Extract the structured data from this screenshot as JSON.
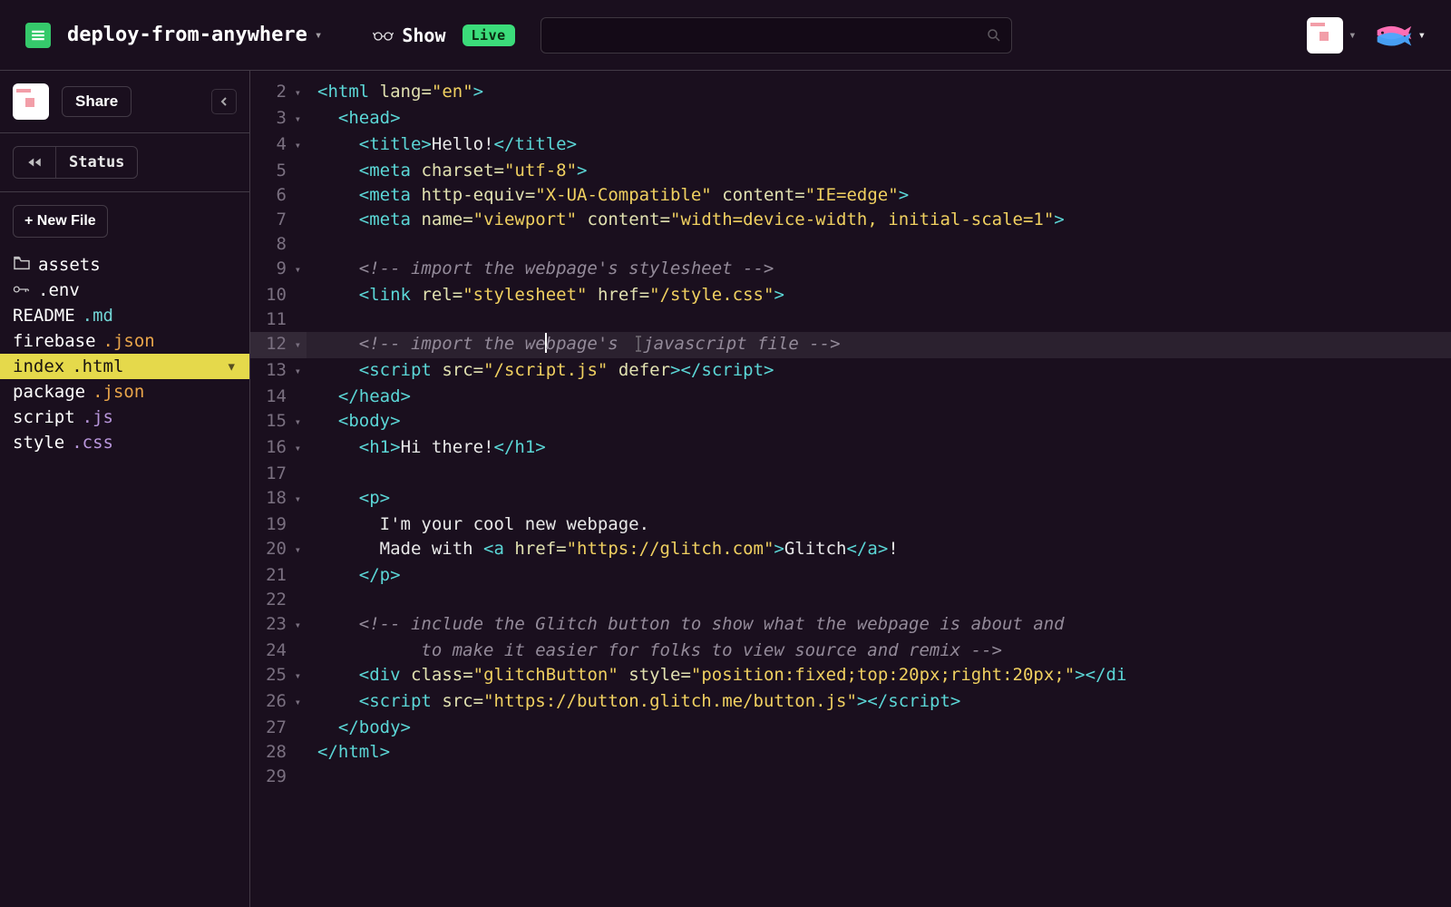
{
  "header": {
    "project_name": "deploy-from-anywhere",
    "show_label": "Show",
    "live_badge": "Live",
    "search_placeholder": ""
  },
  "sidebar": {
    "share_label": "Share",
    "status_label": "Status",
    "new_file_label": "+ New File",
    "files": [
      {
        "icon": "folder",
        "name": "assets",
        "ext": "",
        "active": false,
        "iconGlyph": "📁"
      },
      {
        "icon": "key",
        "name": ".env",
        "ext": "",
        "active": false,
        "iconGlyph": "🔑"
      },
      {
        "icon": "",
        "name": "README",
        "ext": ".md",
        "extClass": "ext-md",
        "active": false
      },
      {
        "icon": "",
        "name": "firebase",
        "ext": ".json",
        "extClass": "ext-json",
        "active": false
      },
      {
        "icon": "",
        "name": "index",
        "ext": ".html",
        "extClass": "ext-html",
        "active": true
      },
      {
        "icon": "",
        "name": "package",
        "ext": ".json",
        "extClass": "ext-json",
        "active": false
      },
      {
        "icon": "",
        "name": "script",
        "ext": ".js",
        "extClass": "ext-js",
        "active": false
      },
      {
        "icon": "",
        "name": "style",
        "ext": ".css",
        "extClass": "ext-css",
        "active": false
      }
    ]
  },
  "editor": {
    "highlight_line": 12,
    "lines": [
      {
        "n": 2,
        "fold": true,
        "indent": 0,
        "tokens": [
          [
            "tag",
            "<"
          ],
          [
            "name",
            "html"
          ],
          [
            "text",
            " "
          ],
          [
            "attr",
            "lang"
          ],
          [
            "eq",
            "="
          ],
          [
            "str",
            "\"en\""
          ],
          [
            "tag",
            ">"
          ]
        ]
      },
      {
        "n": 3,
        "fold": true,
        "indent": 1,
        "tokens": [
          [
            "tag",
            "<"
          ],
          [
            "name",
            "head"
          ],
          [
            "tag",
            ">"
          ]
        ]
      },
      {
        "n": 4,
        "fold": true,
        "indent": 2,
        "tokens": [
          [
            "tag",
            "<"
          ],
          [
            "name",
            "title"
          ],
          [
            "tag",
            ">"
          ],
          [
            "text",
            "Hello!"
          ],
          [
            "tag",
            "</"
          ],
          [
            "name",
            "title"
          ],
          [
            "tag",
            ">"
          ]
        ]
      },
      {
        "n": 5,
        "fold": false,
        "indent": 2,
        "tokens": [
          [
            "tag",
            "<"
          ],
          [
            "name",
            "meta"
          ],
          [
            "text",
            " "
          ],
          [
            "attr",
            "charset"
          ],
          [
            "eq",
            "="
          ],
          [
            "str",
            "\"utf-8\""
          ],
          [
            "tag",
            ">"
          ]
        ]
      },
      {
        "n": 6,
        "fold": false,
        "indent": 2,
        "tokens": [
          [
            "tag",
            "<"
          ],
          [
            "name",
            "meta"
          ],
          [
            "text",
            " "
          ],
          [
            "attr",
            "http-equiv"
          ],
          [
            "eq",
            "="
          ],
          [
            "str",
            "\"X-UA-Compatible\""
          ],
          [
            "text",
            " "
          ],
          [
            "attr",
            "content"
          ],
          [
            "eq",
            "="
          ],
          [
            "str",
            "\"IE=edge\""
          ],
          [
            "tag",
            ">"
          ]
        ]
      },
      {
        "n": 7,
        "fold": false,
        "indent": 2,
        "tokens": [
          [
            "tag",
            "<"
          ],
          [
            "name",
            "meta"
          ],
          [
            "text",
            " "
          ],
          [
            "attr",
            "name"
          ],
          [
            "eq",
            "="
          ],
          [
            "str",
            "\"viewport\""
          ],
          [
            "text",
            " "
          ],
          [
            "attr",
            "content"
          ],
          [
            "eq",
            "="
          ],
          [
            "str",
            "\"width=device-width, initial-scale=1\""
          ],
          [
            "tag",
            ">"
          ]
        ]
      },
      {
        "n": 8,
        "fold": false,
        "indent": 0,
        "tokens": []
      },
      {
        "n": 9,
        "fold": true,
        "indent": 2,
        "tokens": [
          [
            "comment",
            "<!-- import the webpage's stylesheet -->"
          ]
        ]
      },
      {
        "n": 10,
        "fold": false,
        "indent": 2,
        "tokens": [
          [
            "tag",
            "<"
          ],
          [
            "name",
            "link"
          ],
          [
            "text",
            " "
          ],
          [
            "attr",
            "rel"
          ],
          [
            "eq",
            "="
          ],
          [
            "str",
            "\"stylesheet\""
          ],
          [
            "text",
            " "
          ],
          [
            "attr",
            "href"
          ],
          [
            "eq",
            "="
          ],
          [
            "str",
            "\"/style.css\""
          ],
          [
            "tag",
            ">"
          ]
        ]
      },
      {
        "n": 11,
        "fold": false,
        "indent": 0,
        "tokens": []
      },
      {
        "n": 12,
        "fold": true,
        "indent": 2,
        "tokens": [
          [
            "comment",
            "<!-- import the we"
          ],
          [
            "cursor",
            ""
          ],
          [
            "comment",
            "bpage's "
          ],
          [
            "ibeam",
            ""
          ],
          [
            "comment",
            "javascript file -->"
          ]
        ]
      },
      {
        "n": 13,
        "fold": true,
        "indent": 2,
        "tokens": [
          [
            "tag",
            "<"
          ],
          [
            "name",
            "script"
          ],
          [
            "text",
            " "
          ],
          [
            "attr",
            "src"
          ],
          [
            "eq",
            "="
          ],
          [
            "str",
            "\"/script.js\""
          ],
          [
            "text",
            " "
          ],
          [
            "attr",
            "defer"
          ],
          [
            "tag",
            ">"
          ],
          [
            "tag",
            "</"
          ],
          [
            "name",
            "script"
          ],
          [
            "tag",
            ">"
          ]
        ]
      },
      {
        "n": 14,
        "fold": false,
        "indent": 1,
        "tokens": [
          [
            "tag",
            "</"
          ],
          [
            "name",
            "head"
          ],
          [
            "tag",
            ">"
          ]
        ]
      },
      {
        "n": 15,
        "fold": true,
        "indent": 1,
        "tokens": [
          [
            "tag",
            "<"
          ],
          [
            "name",
            "body"
          ],
          [
            "tag",
            ">"
          ]
        ]
      },
      {
        "n": 16,
        "fold": true,
        "indent": 2,
        "tokens": [
          [
            "tag",
            "<"
          ],
          [
            "name",
            "h1"
          ],
          [
            "tag",
            ">"
          ],
          [
            "text",
            "Hi there!"
          ],
          [
            "tag",
            "</"
          ],
          [
            "name",
            "h1"
          ],
          [
            "tag",
            ">"
          ]
        ]
      },
      {
        "n": 17,
        "fold": false,
        "indent": 0,
        "tokens": []
      },
      {
        "n": 18,
        "fold": true,
        "indent": 2,
        "tokens": [
          [
            "tag",
            "<"
          ],
          [
            "name",
            "p"
          ],
          [
            "tag",
            ">"
          ]
        ]
      },
      {
        "n": 19,
        "fold": false,
        "indent": 3,
        "tokens": [
          [
            "text",
            "I'm your cool new webpage."
          ]
        ]
      },
      {
        "n": 20,
        "fold": true,
        "indent": 3,
        "tokens": [
          [
            "text",
            "Made with "
          ],
          [
            "tag",
            "<"
          ],
          [
            "name",
            "a"
          ],
          [
            "text",
            " "
          ],
          [
            "attr",
            "href"
          ],
          [
            "eq",
            "="
          ],
          [
            "str",
            "\"https://glitch.com\""
          ],
          [
            "tag",
            ">"
          ],
          [
            "text",
            "Glitch"
          ],
          [
            "tag",
            "</"
          ],
          [
            "name",
            "a"
          ],
          [
            "tag",
            ">"
          ],
          [
            "text",
            "!"
          ]
        ]
      },
      {
        "n": 21,
        "fold": false,
        "indent": 2,
        "tokens": [
          [
            "tag",
            "</"
          ],
          [
            "name",
            "p"
          ],
          [
            "tag",
            ">"
          ]
        ]
      },
      {
        "n": 22,
        "fold": false,
        "indent": 0,
        "tokens": []
      },
      {
        "n": 23,
        "fold": true,
        "indent": 2,
        "tokens": [
          [
            "comment",
            "<!-- include the Glitch button to show what the webpage is about and"
          ]
        ]
      },
      {
        "n": 24,
        "fold": false,
        "indent": 5,
        "tokens": [
          [
            "comment",
            "to make it easier for folks to view source and remix -->"
          ]
        ]
      },
      {
        "n": 25,
        "fold": true,
        "indent": 2,
        "tokens": [
          [
            "tag",
            "<"
          ],
          [
            "name",
            "div"
          ],
          [
            "text",
            " "
          ],
          [
            "attr",
            "class"
          ],
          [
            "eq",
            "="
          ],
          [
            "str",
            "\"glitchButton\""
          ],
          [
            "text",
            " "
          ],
          [
            "attr",
            "style"
          ],
          [
            "eq",
            "="
          ],
          [
            "str",
            "\"position:fixed;top:20px;right:20px;\""
          ],
          [
            "tag",
            ">"
          ],
          [
            "tag",
            "</"
          ],
          [
            "name",
            "di"
          ]
        ]
      },
      {
        "n": 26,
        "fold": true,
        "indent": 2,
        "tokens": [
          [
            "tag",
            "<"
          ],
          [
            "name",
            "script"
          ],
          [
            "text",
            " "
          ],
          [
            "attr",
            "src"
          ],
          [
            "eq",
            "="
          ],
          [
            "str",
            "\"https://button.glitch.me/button.js\""
          ],
          [
            "tag",
            ">"
          ],
          [
            "tag",
            "</"
          ],
          [
            "name",
            "script"
          ],
          [
            "tag",
            ">"
          ]
        ]
      },
      {
        "n": 27,
        "fold": false,
        "indent": 1,
        "tokens": [
          [
            "tag",
            "</"
          ],
          [
            "name",
            "body"
          ],
          [
            "tag",
            ">"
          ]
        ]
      },
      {
        "n": 28,
        "fold": false,
        "indent": 0,
        "tokens": [
          [
            "tag",
            "</"
          ],
          [
            "name",
            "html"
          ],
          [
            "tag",
            ">"
          ]
        ]
      },
      {
        "n": 29,
        "fold": false,
        "indent": 0,
        "tokens": []
      }
    ]
  }
}
